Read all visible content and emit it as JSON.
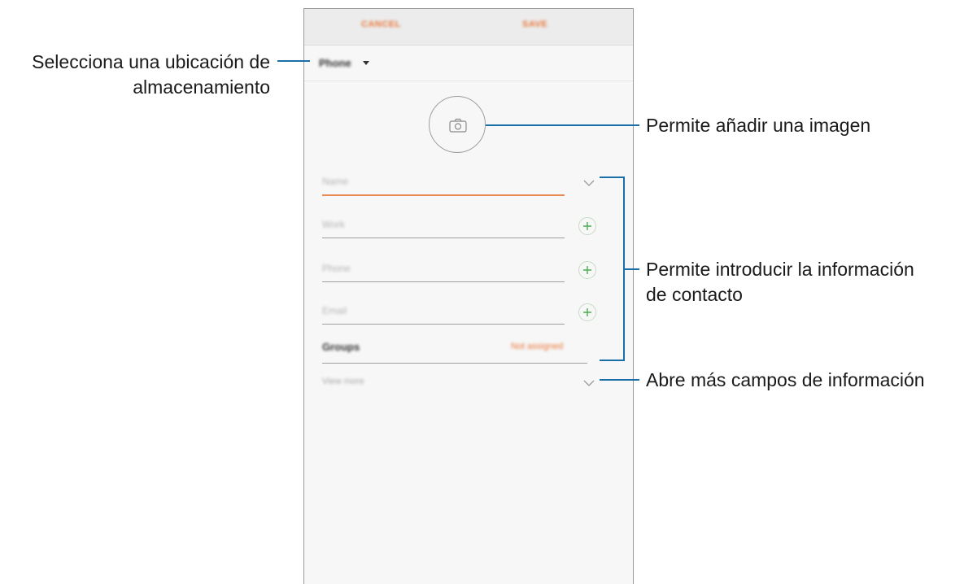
{
  "topbar": {
    "cancel_label": "CANCEL",
    "save_label": "SAVE"
  },
  "storage": {
    "label": "Phone"
  },
  "fields": {
    "name": "Name",
    "work": "Work",
    "phone": "Phone",
    "email": "Email"
  },
  "groups": {
    "label": "Groups",
    "value": "Not assigned"
  },
  "view_more": {
    "label": "View more"
  },
  "callouts": {
    "storage_line1": "Selecciona una ubicación de",
    "storage_line2": "almacenamiento",
    "image": "Permite añadir una imagen",
    "info_line1": "Permite introducir la información",
    "info_line2": "de contacto",
    "more": "Abre más campos de información"
  },
  "colors": {
    "accent": "#e8773a",
    "callout_line": "#1a6fa8",
    "plus_green": "#4caf50"
  },
  "icons": {
    "camera": "camera-icon",
    "caret": "caret-down-icon",
    "chevron": "chevron-down-icon",
    "plus": "plus-icon"
  }
}
